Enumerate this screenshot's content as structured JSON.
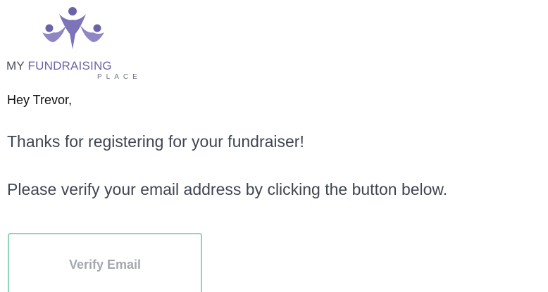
{
  "logo": {
    "icon": "people-celebrating-logo-icon",
    "line1_my": "MY",
    "line1_fundraising": "FUNDRAISING",
    "line2": "PLACE",
    "colors": {
      "brand_purple": "#6b63a8",
      "dark_gray": "#4a4f57"
    }
  },
  "greeting": "Hey Trevor,",
  "body": {
    "paragraph1": "Thanks for registering for your fundraiser!",
    "paragraph2": "Please verify your email address by clicking the button below."
  },
  "button": {
    "label": "Verify Email",
    "border_color": "#8fd5b6"
  }
}
